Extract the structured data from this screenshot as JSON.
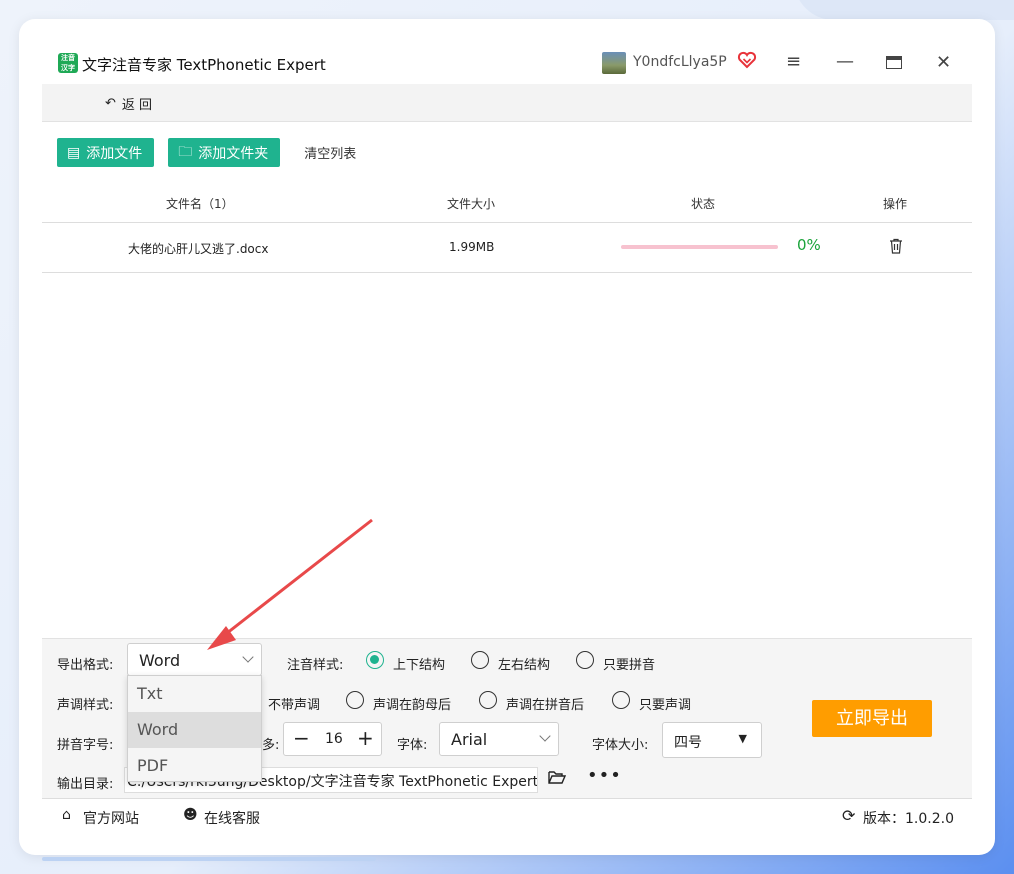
{
  "app": {
    "title": "文字注音专家 TextPhonetic Expert",
    "logo_text": "注音 汉字",
    "username": "Y0ndfcLlya5P"
  },
  "nav": {
    "back_label": "返 回"
  },
  "toolbar": {
    "add_file": "添加文件",
    "add_folder": "添加文件夹",
    "clear_list": "清空列表"
  },
  "table": {
    "headers": {
      "filename": "文件名（1）",
      "size": "文件大小",
      "status": "状态",
      "action": "操作"
    },
    "rows": [
      {
        "filename": "大佬的心肝儿又逃了.docx",
        "size": "1.99MB",
        "progress": "0%"
      }
    ]
  },
  "settings": {
    "export_format_label": "导出格式:",
    "export_format_value": "Word",
    "export_format_options": [
      "Txt",
      "Word",
      "PDF"
    ],
    "phonetic_style_label": "注音样式:",
    "phonetic_styles": [
      "上下结构",
      "左右结构",
      "只要拼音"
    ],
    "phonetic_style_selected": "上下结构",
    "tone_style_label": "声调样式:",
    "tone_styles": [
      "不带声调",
      "声调在韵母后",
      "声调在拼音后",
      "只要声调"
    ],
    "pinyin_size_label": "拼音字号:",
    "pinyin_size_suffix": "多:",
    "pinyin_size_value": "16",
    "font_label": "字体:",
    "font_value": "Arial",
    "font_size_label": "字体大小:",
    "font_size_value": "四号",
    "output_dir_label": "输出目录:",
    "output_dir_value": "C:/Users/rkl3ung/Desktop/文字注音专家 TextPhonetic Expert",
    "export_button": "立即导出"
  },
  "footer": {
    "website": "官方网站",
    "support": "在线客服",
    "version_label": "版本：1.0.2.0"
  },
  "colors": {
    "accent": "#1fb38f",
    "export": "#ff9d00",
    "progress_text": "#1aa33a",
    "annotation_arrow": "#e8494a"
  }
}
